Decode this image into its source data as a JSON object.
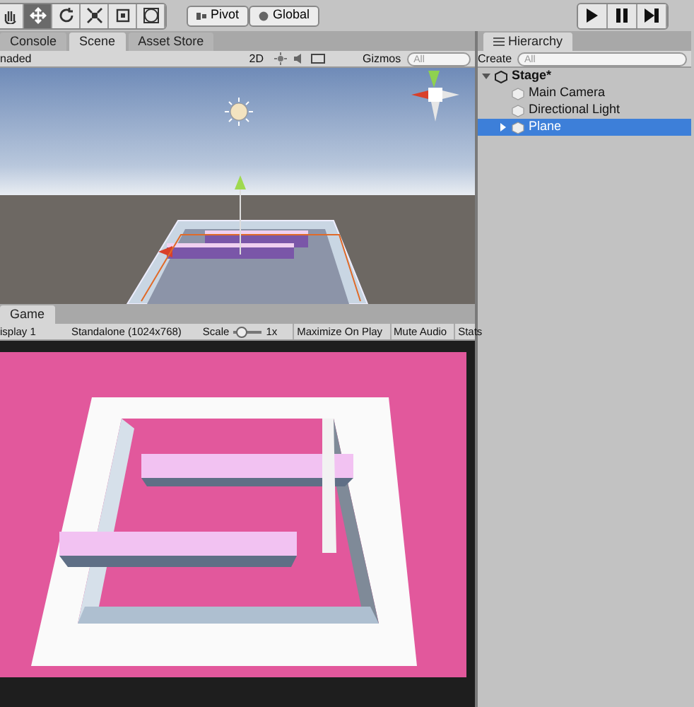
{
  "toolbar": {
    "tools": [
      {
        "kind": "hand",
        "selected": false
      },
      {
        "kind": "move",
        "selected": true
      },
      {
        "kind": "rotate",
        "selected": false
      },
      {
        "kind": "scale",
        "selected": false
      },
      {
        "kind": "rect",
        "selected": false
      },
      {
        "kind": "transform",
        "selected": false
      }
    ],
    "pivot": "Pivot",
    "global": "Global",
    "playback": [
      {
        "kind": "play"
      },
      {
        "kind": "pause"
      },
      {
        "kind": "step"
      }
    ]
  },
  "scene_panel": {
    "tabs": [
      {
        "label": "Console",
        "selected": false
      },
      {
        "label": "Scene",
        "selected": true
      },
      {
        "label": "Asset Store",
        "selected": false
      }
    ],
    "shading": "naded",
    "mode_2d": "2D",
    "gizmos": "Gizmos",
    "search": {
      "placeholder": "All"
    }
  },
  "game_panel": {
    "tabs": [
      {
        "label": "Game",
        "selected": true
      }
    ],
    "display": "isplay 1",
    "resolution": "Standalone (1024x768)",
    "scale_label": "Scale",
    "scale": {
      "level": 0.1
    },
    "scale_value": "1x",
    "toggles": [
      {
        "label": "Maximize On Play",
        "on": false
      },
      {
        "label": "Mute Audio",
        "on": false
      },
      {
        "label": "Stats",
        "on": false
      }
    ]
  },
  "hierarchy": {
    "tab": "Hierarchy",
    "create": "Create",
    "search": {
      "placeholder": "All"
    },
    "tree": [
      {
        "label": "Stage*",
        "kind": "scene",
        "expanded": true,
        "selected": false,
        "children": [
          {
            "label": "Main Camera",
            "kind": "object",
            "selected": false
          },
          {
            "label": "Directional Light",
            "kind": "object",
            "selected": false
          },
          {
            "label": "Plane",
            "kind": "object",
            "expanded": false,
            "selected": true
          }
        ]
      }
    ]
  }
}
